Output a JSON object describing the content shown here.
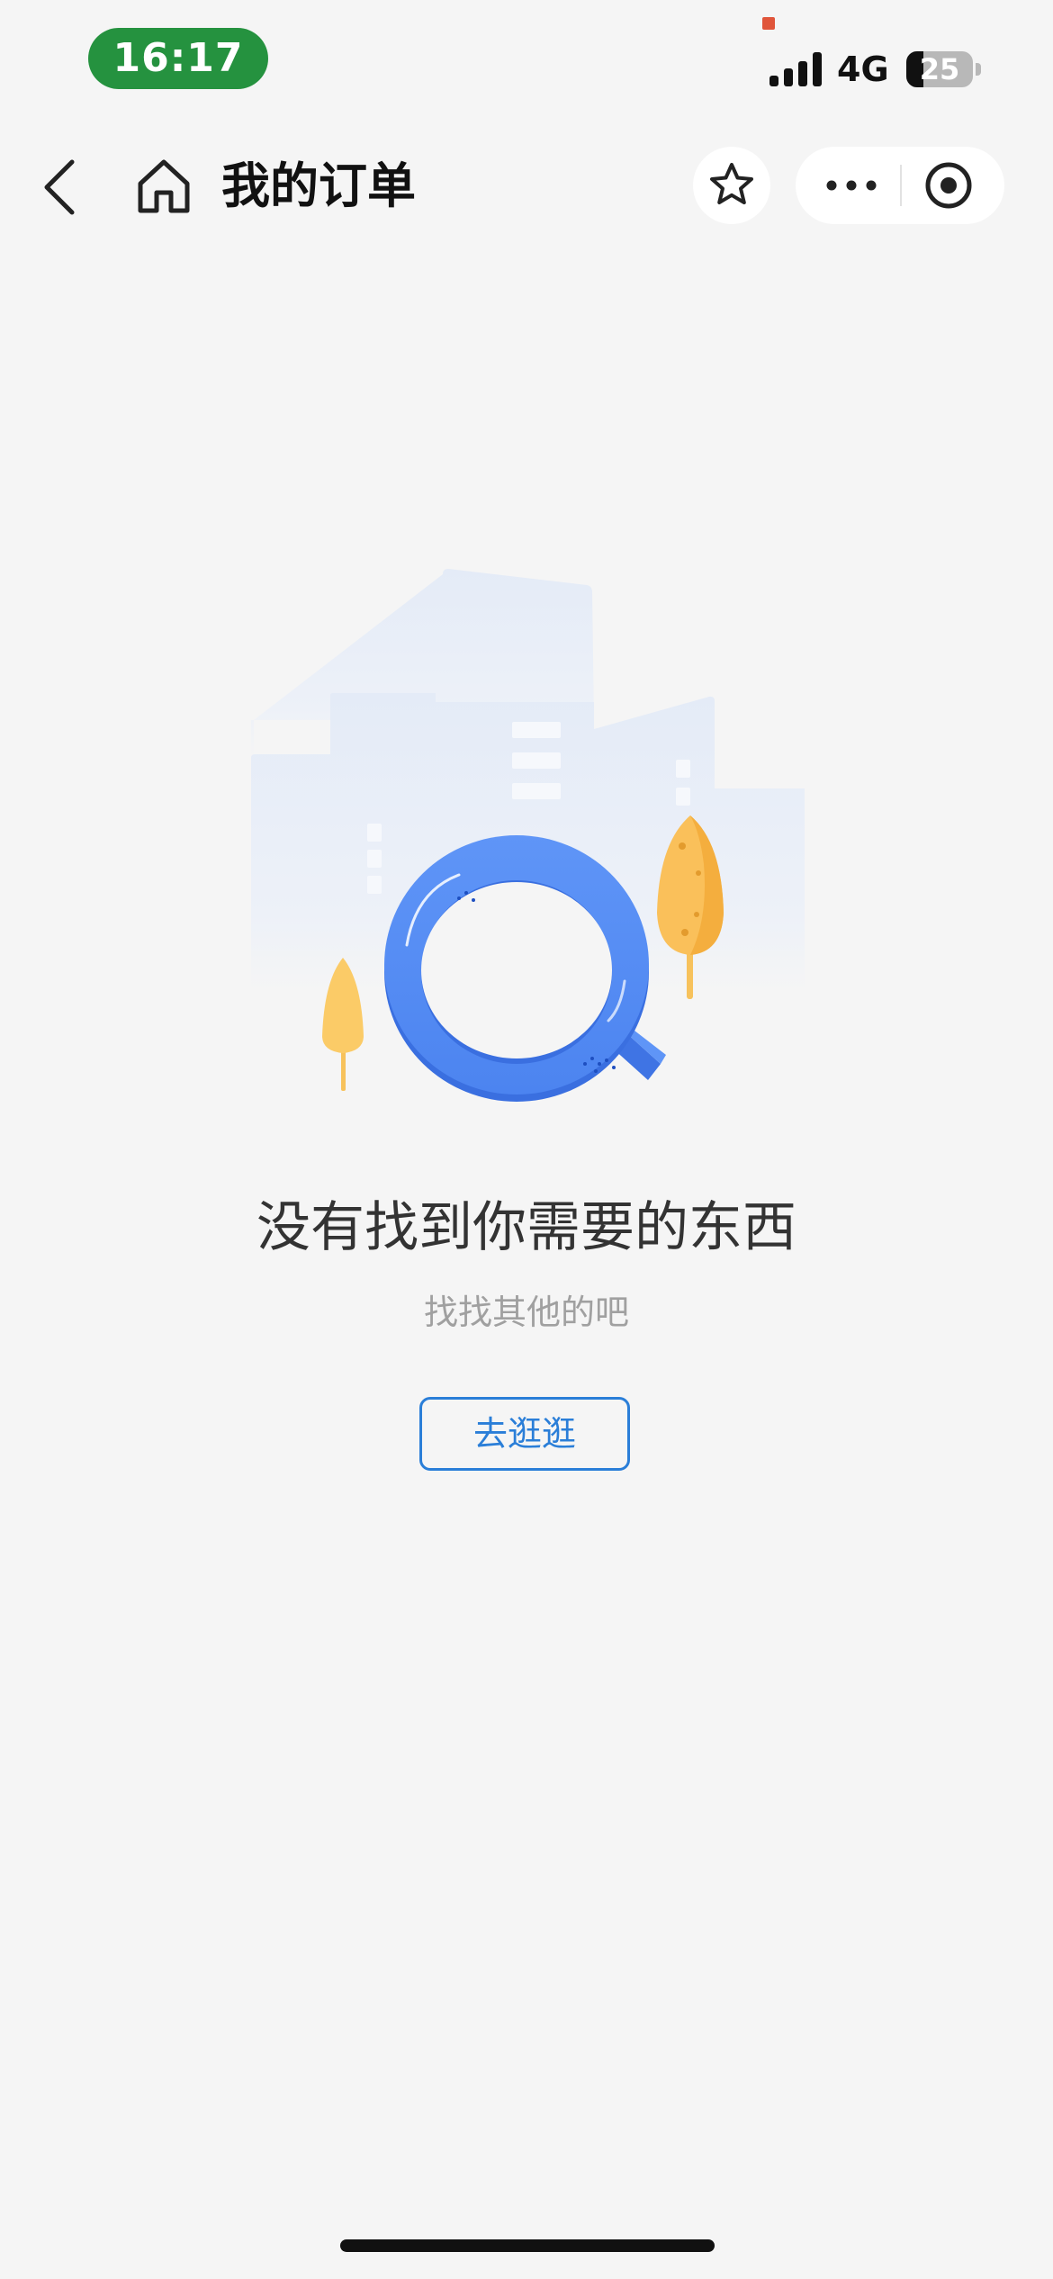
{
  "status_bar": {
    "time": "16:17",
    "network": "4G",
    "battery_level": "25",
    "battery_fraction": 0.25,
    "signal_bars": 4
  },
  "nav": {
    "back_icon": "chevron-left-icon",
    "home_icon": "home-icon",
    "title": "我的订单",
    "favorite_icon": "star-icon",
    "more_icon": "more-dots-icon",
    "close_icon": "target-circle-icon"
  },
  "empty_state": {
    "illustration_icon": "magnifier-search-icon",
    "title": "没有找到你需要的东西",
    "subtitle": "找找其他的吧",
    "button_label": "去逛逛"
  },
  "colors": {
    "background": "#f5f5f5",
    "accent_blue": "#2a7ed8",
    "status_green": "#25923f"
  }
}
